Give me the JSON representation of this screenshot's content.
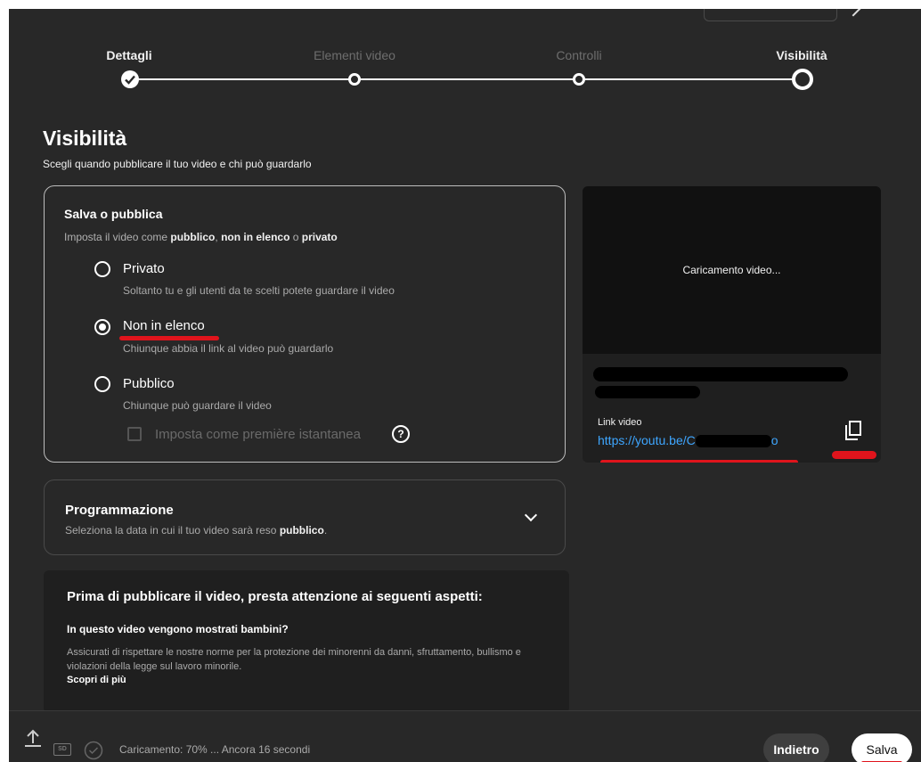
{
  "stepper": {
    "steps": [
      {
        "label": "Dettagli",
        "state": "done"
      },
      {
        "label": "Elementi video",
        "state": "inactive"
      },
      {
        "label": "Controlli",
        "state": "inactive"
      },
      {
        "label": "Visibilità",
        "state": "current"
      }
    ]
  },
  "page": {
    "title": "Visibilità",
    "subtitle": "Scegli quando pubblicare il tuo video e chi può guardarlo"
  },
  "save_publish": {
    "title": "Salva o pubblica",
    "desc_prefix": "Imposta il video come ",
    "desc_public": "pubblico",
    "desc_sep1": ", ",
    "desc_unlisted": "non in elenco",
    "desc_sep2": " o ",
    "desc_private": "privato",
    "options": [
      {
        "label": "Privato",
        "desc": "Soltanto tu e gli utenti da te scelti potete guardare il video",
        "selected": false
      },
      {
        "label": "Non in elenco",
        "desc": "Chiunque abbia il link al video può guardarlo",
        "selected": true
      },
      {
        "label": "Pubblico",
        "desc": "Chiunque può guardare il video",
        "selected": false
      }
    ],
    "premiere_label": "Imposta come première istantanea",
    "premiere_checked": false
  },
  "schedule": {
    "title": "Programmazione",
    "desc_prefix": "Seleziona la data in cui il tuo video sarà reso ",
    "desc_bold": "pubblico",
    "desc_suffix": "."
  },
  "notice": {
    "title": "Prima di pubblicare il video, presta attenzione ai seguenti aspetti:",
    "question": "In questo video vengono mostrati bambini?",
    "text": "Assicurati di rispettare le nostre norme per la protezione dei minorenni da danni, sfruttamento, bullismo e violazioni della legge sul lavoro minorile.",
    "link": "Scopri di più"
  },
  "preview": {
    "loading": "Caricamento video...",
    "link_label": "Link video",
    "link_url": "https://youtu.be/C",
    "link_url_end": "o"
  },
  "footer": {
    "status": "Caricamento: 70% ... Ancora 16 secondi",
    "upload_progress": 0.7,
    "sd_badge": "SD",
    "back_label": "Indietro",
    "save_label": "Salva"
  },
  "colors": {
    "background": "#282828",
    "link": "#3ea6ff",
    "annotation_red": "#e0141c"
  }
}
